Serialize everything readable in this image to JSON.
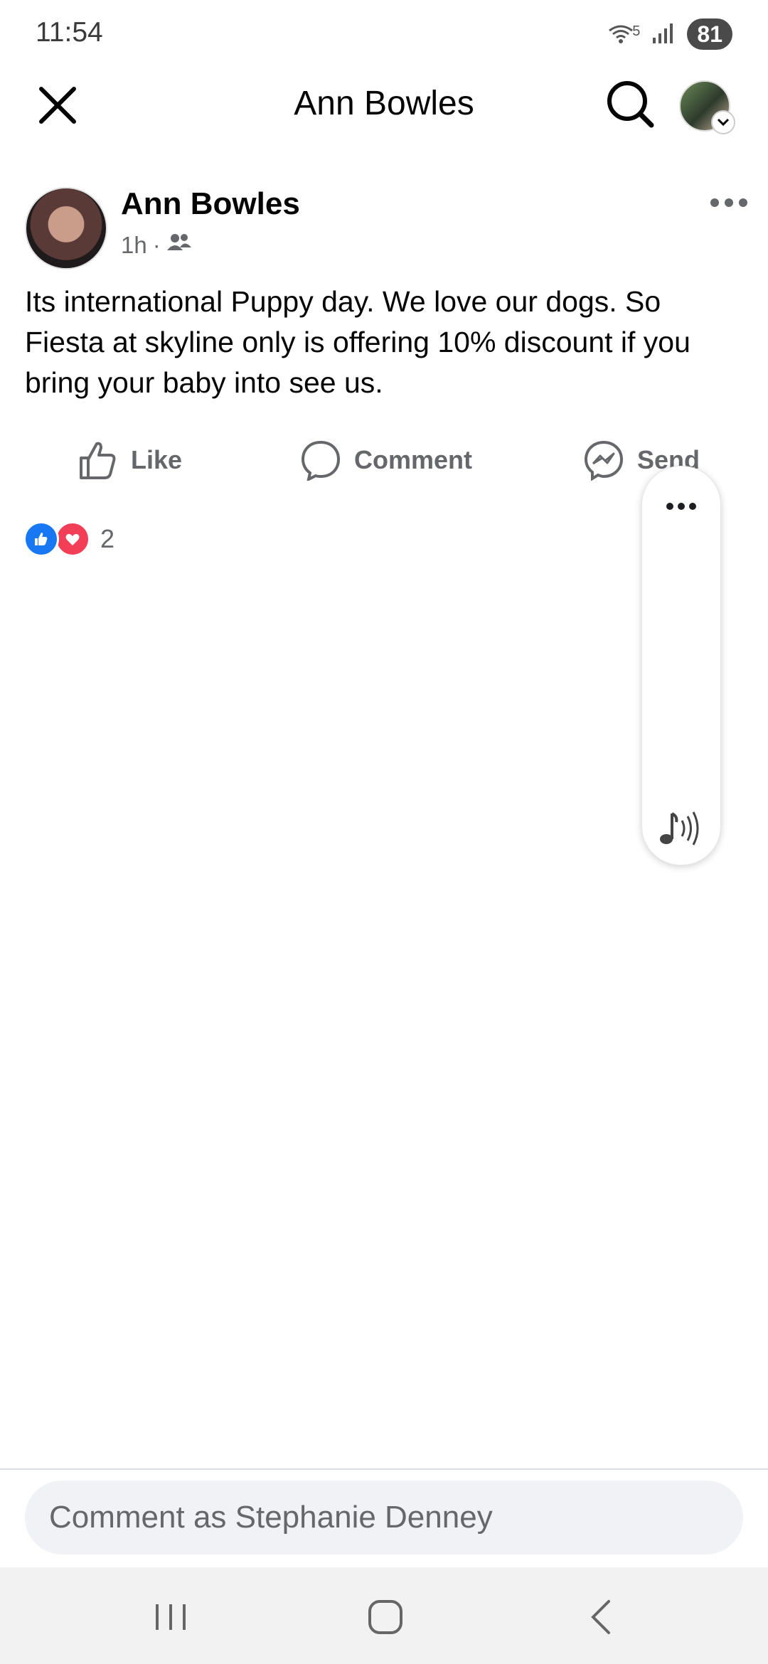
{
  "status_bar": {
    "time": "11:54",
    "wifi_label": "5",
    "battery": "81"
  },
  "header": {
    "title": "Ann Bowles"
  },
  "post": {
    "author": "Ann Bowles",
    "time": "1h",
    "separator": "·",
    "audience_icon": "friends-icon",
    "text": "Its international Puppy day. We love our dogs. So Fiesta at skyline only is offering 10% discount if you bring your baby into see us."
  },
  "actions": {
    "like": "Like",
    "comment": "Comment",
    "send": "Send"
  },
  "reactions": {
    "count": "2",
    "types": [
      "like",
      "love"
    ]
  },
  "comment_box": {
    "placeholder": "Comment as Stephanie Denney"
  },
  "colors": {
    "like_blue": "#1877f2",
    "love_red": "#f33e58",
    "secondary_text": "#65676b"
  }
}
